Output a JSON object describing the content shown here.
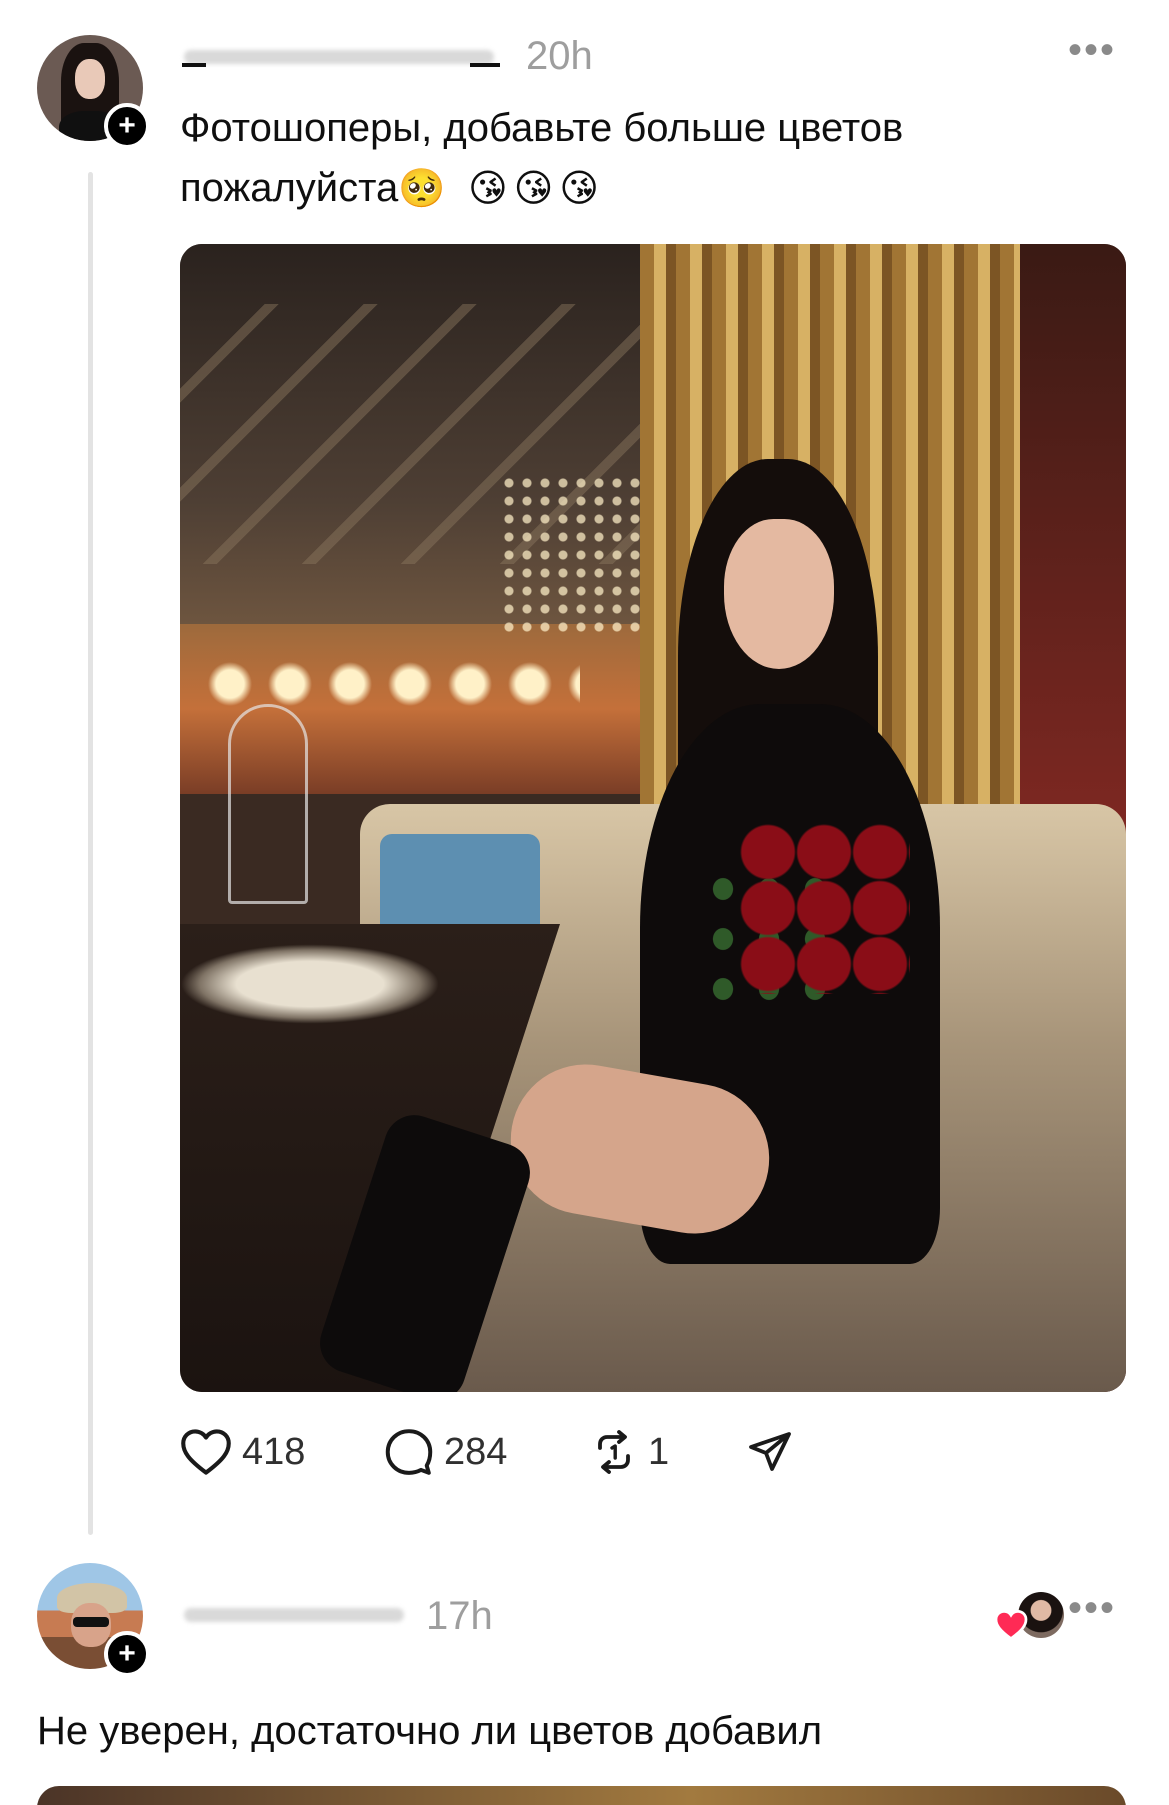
{
  "post": {
    "author_name": "_ı ..._",
    "timestamp": "20h",
    "more_icon": "more-horizontal-icon",
    "text_line1": "Фотошоперы, добавьте больше цветов",
    "text_line2": "пожалуйста",
    "emojis": "🥺 😘😘😘",
    "photo_description_icon": "photo",
    "likes": "418",
    "replies": "284",
    "reposts": "1"
  },
  "reply": {
    "timestamp": "17h",
    "text": "Не уверен, достаточно ли цветов добавил"
  },
  "colors": {
    "text": "#0f0f0f",
    "muted": "#9e9e9e",
    "thread_line": "#e3e3e3",
    "heart_red": "#ff2a55"
  }
}
